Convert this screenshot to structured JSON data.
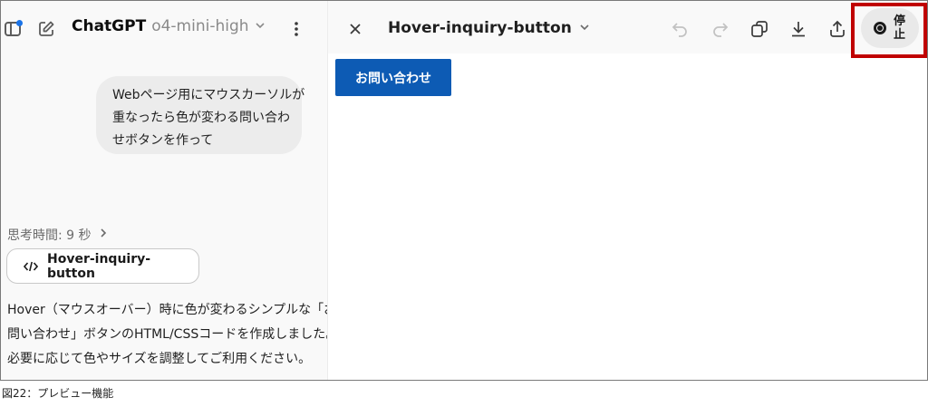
{
  "header": {
    "model_name": "ChatGPT",
    "model_variant": "o4-mini-high"
  },
  "chat": {
    "user_message_lines": [
      "Webページ用にマウスカーソルが",
      "重なったら色が変わる問い合わ",
      "せボタンを作って"
    ],
    "thought_label": "思考時間: 9 秒",
    "artifact_label": "Hover-inquiry-button",
    "reply_lines": [
      "Hover（マウスオーバー）時に色が変わるシンプルな「お",
      "問い合わせ」ボタンのHTML/CSSコードを作成しました。",
      "必要に応じて色やサイズを調整してご利用ください。"
    ]
  },
  "preview": {
    "title": "Hover-inquiry-button",
    "stop_label": "停止",
    "button_label": "お問い合わせ",
    "button_color": "#0d5bb4"
  },
  "highlight_color": "#c00000",
  "caption": "図22：プレビュー機能"
}
